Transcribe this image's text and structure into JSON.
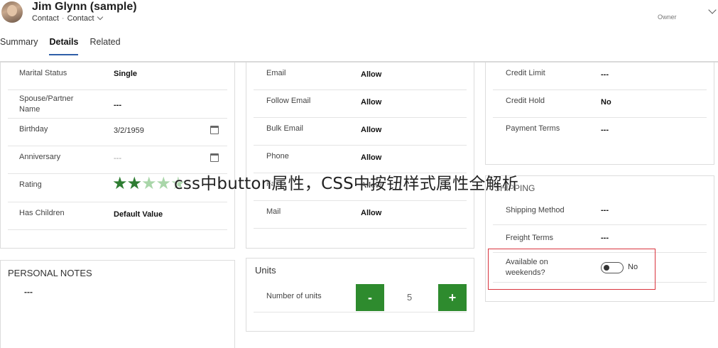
{
  "header": {
    "title": "Jim Glynn (sample)",
    "entity": "Contact",
    "form": "Contact",
    "owner_label": "Owner"
  },
  "tabs": [
    {
      "label": "Summary"
    },
    {
      "label": "Details",
      "active": true
    },
    {
      "label": "Related"
    }
  ],
  "personal": {
    "rows": [
      {
        "label": "Marital Status",
        "value": "Single"
      },
      {
        "label": "Spouse/Partner Name",
        "value": "---"
      },
      {
        "label": "Birthday",
        "value": "3/2/1959"
      },
      {
        "label": "Anniversary",
        "value": "---"
      },
      {
        "label": "Rating",
        "value": ""
      },
      {
        "label": "Has Children",
        "value": "Default Value"
      }
    ],
    "rating": {
      "filled": 2,
      "total": 5
    }
  },
  "contact_preferences": {
    "rows": [
      {
        "label": "Email",
        "value": "Allow"
      },
      {
        "label": "Follow Email",
        "value": "Allow"
      },
      {
        "label": "Bulk Email",
        "value": "Allow"
      },
      {
        "label": "Phone",
        "value": "Allow"
      },
      {
        "label": "Fax",
        "value": "Allow"
      },
      {
        "label": "Mail",
        "value": "Allow"
      }
    ]
  },
  "billing": {
    "rows": [
      {
        "label": "Credit Limit",
        "value": "---"
      },
      {
        "label": "Credit Hold",
        "value": "No"
      },
      {
        "label": "Payment Terms",
        "value": "---"
      }
    ]
  },
  "shipping": {
    "title": "SHIPPING",
    "rows": [
      {
        "label": "Shipping Method",
        "value": "---"
      },
      {
        "label": "Freight Terms",
        "value": "---"
      },
      {
        "label": "Available on weekends?",
        "value": "No"
      }
    ]
  },
  "personal_notes": {
    "title": "PERSONAL NOTES",
    "value": "---"
  },
  "units": {
    "title": "Units",
    "label": "Number of units",
    "value": "5",
    "minus": "-",
    "plus": "+"
  },
  "watermark": "css中button属性，CSS中按钮样式属性全解析",
  "colors": {
    "accent_green": "#2e8b2e",
    "star_filled": "#2e7d32",
    "star_empty": "#a9d6a9",
    "highlight_red": "#d9343d",
    "tab_underline": "#2f5fa8"
  }
}
